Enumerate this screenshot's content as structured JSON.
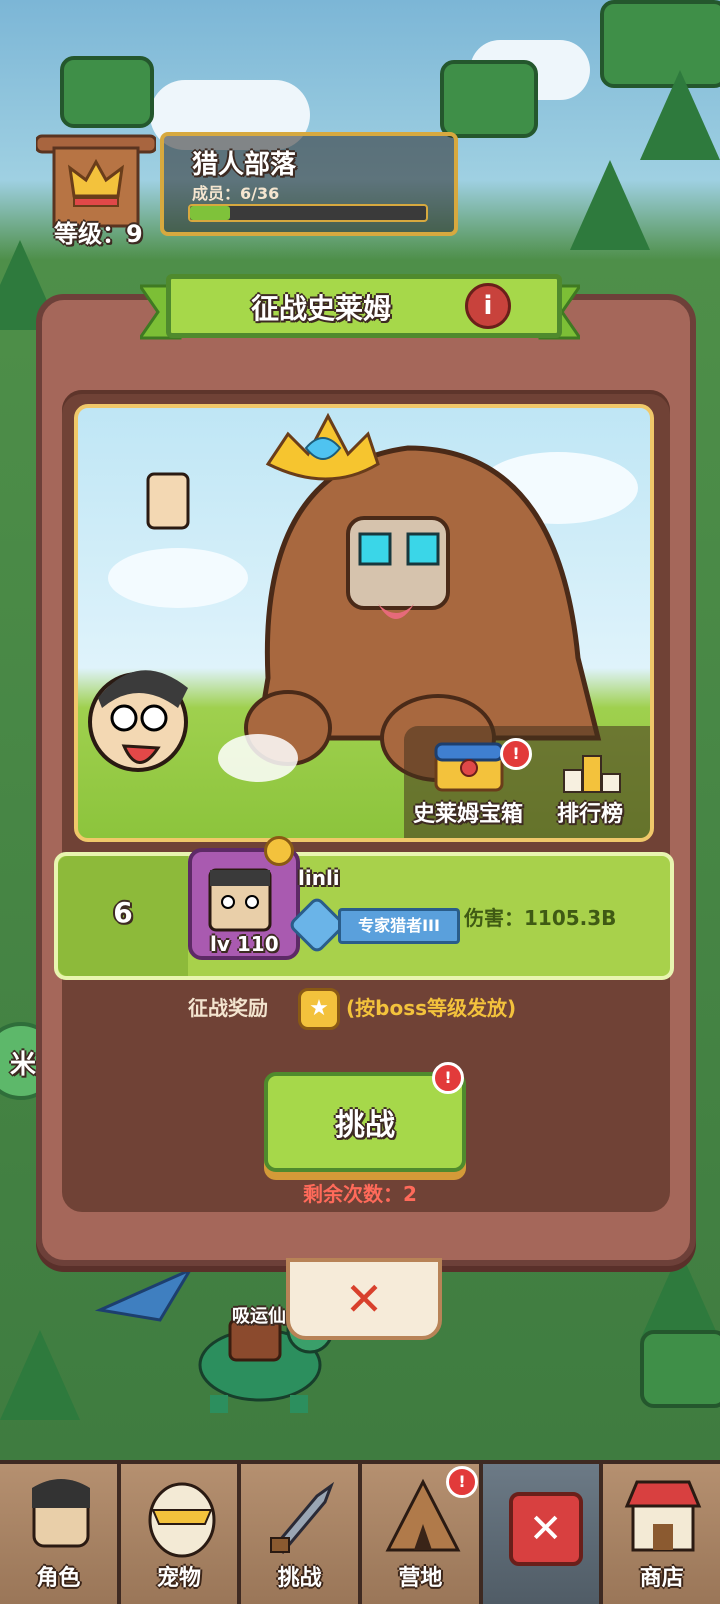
{
  "tribe": {
    "name": "猎人部落",
    "members_label": "成员：",
    "members_value": "6/36",
    "level_label": "等级：",
    "level_value": "9",
    "members_progress": 0.17
  },
  "dialog": {
    "title": "征战史莱姆",
    "info_glyph": "i",
    "chest_label": "史莱姆宝箱",
    "rank_label": "排行榜"
  },
  "player": {
    "rank": "6",
    "name": "linli",
    "level": "lv 110",
    "title_badge": "专家猎者III",
    "damage_label": "伤害：",
    "damage_value": "1105.3B"
  },
  "reward": {
    "label": "征战奖励",
    "note": "(按boss等级发放)"
  },
  "challenge": {
    "button_label": "挑战",
    "remaining_label": "剩余次数：",
    "remaining_value": "2",
    "alert_glyph": "!"
  },
  "background": {
    "player_tag": "吸运仙",
    "side_button_glyph": "米"
  },
  "close_glyph": "✕",
  "nav": [
    {
      "label": "角色",
      "icon": "character-icon"
    },
    {
      "label": "宠物",
      "icon": "pet-egg-icon"
    },
    {
      "label": "挑战",
      "icon": "sword-icon"
    },
    {
      "label": "营地",
      "icon": "camp-tent-icon"
    },
    {
      "label": "",
      "icon": "close-icon"
    },
    {
      "label": "商店",
      "icon": "shop-icon"
    }
  ],
  "colors": {
    "panel": "#a5675a",
    "panel_inner": "#704236",
    "green_button": "#a6d84a",
    "remaining_text": "#ff6a5a",
    "alert": "#e23a3a"
  }
}
